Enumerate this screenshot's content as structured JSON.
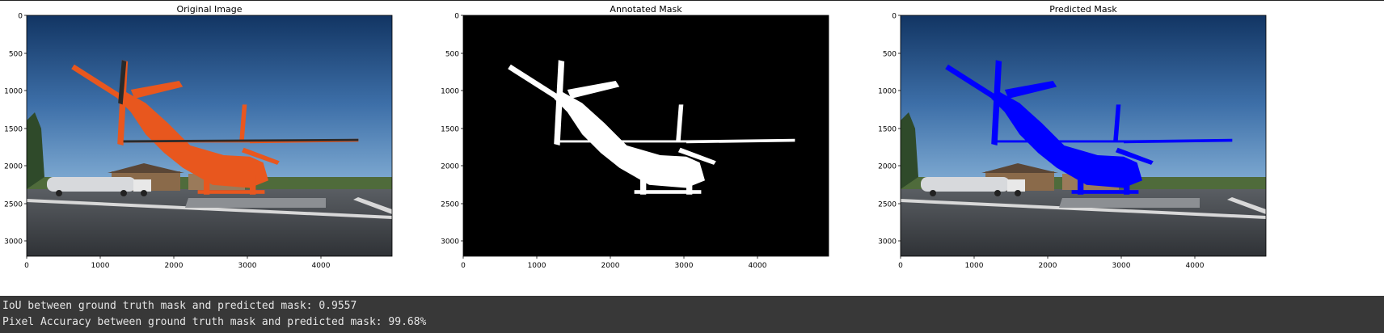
{
  "panels": [
    {
      "key": "original",
      "title": "Original Image",
      "yticks": [
        "0",
        "500",
        "1000",
        "1500",
        "2000",
        "2500",
        "3000"
      ],
      "xticks": [
        "0",
        "1000",
        "2000",
        "3000",
        "4000"
      ]
    },
    {
      "key": "annotated",
      "title": "Annotated Mask",
      "yticks": [
        "0",
        "500",
        "1000",
        "1500",
        "2000",
        "2500",
        "3000"
      ],
      "xticks": [
        "0",
        "1000",
        "2000",
        "3000",
        "4000"
      ]
    },
    {
      "key": "predicted",
      "title": "Predicted Mask",
      "yticks": [
        "0",
        "500",
        "1000",
        "1500",
        "2000",
        "2500",
        "3000"
      ],
      "xticks": [
        "0",
        "1000",
        "2000",
        "3000",
        "4000"
      ]
    }
  ],
  "output": {
    "iou_line": "IoU between ground truth mask and predicted mask: 0.9557",
    "pixel_accuracy_line": "Pixel Accuracy between ground truth mask and predicted mask: 99.68%"
  },
  "colors": {
    "mask_foreground": "#ffffff",
    "mask_background": "#000000",
    "prediction_overlay": "#0000ff",
    "helicopter": "#e8571e",
    "sky_top": "#163a6a",
    "sky_bottom": "#5d8fc4",
    "output_background": "#383838"
  }
}
